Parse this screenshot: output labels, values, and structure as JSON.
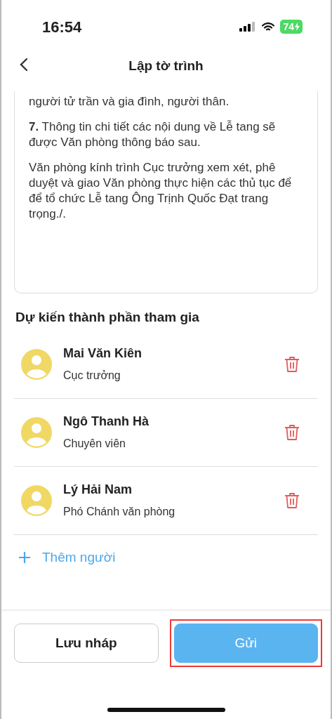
{
  "status_bar": {
    "time": "16:54",
    "battery": "74",
    "charging": true
  },
  "header": {
    "title": "Lập tờ trình"
  },
  "document": {
    "paragraphs": [
      "người tử trần và gia đình, người thân.",
      "**7.** Thông tin chi tiết các nội dung về Lễ tang sẽ được Văn phòng thông báo sau.",
      "Văn phòng kính trình Cục trưởng xem xét, phê duyệt và giao Văn phòng thực hiện các thủ tục để để tổ chức Lễ tang Ông Trịnh Quốc Đạt trang trọng./."
    ]
  },
  "participants": {
    "title": "Dự kiến thành phần tham gia",
    "people": [
      {
        "name": "Mai Văn Kiên",
        "role": "Cục trưởng"
      },
      {
        "name": "Ngô Thanh Hà",
        "role": "Chuyên viên"
      },
      {
        "name": "Lý Hải Nam",
        "role": "Phó Chánh văn phòng"
      }
    ],
    "add_label": "Thêm người"
  },
  "buttons": [
    {
      "label": "Lưu nháp",
      "kind": "outline",
      "highlighted": false
    },
    {
      "label": "Gửi",
      "kind": "primary",
      "highlighted": true
    }
  ]
}
